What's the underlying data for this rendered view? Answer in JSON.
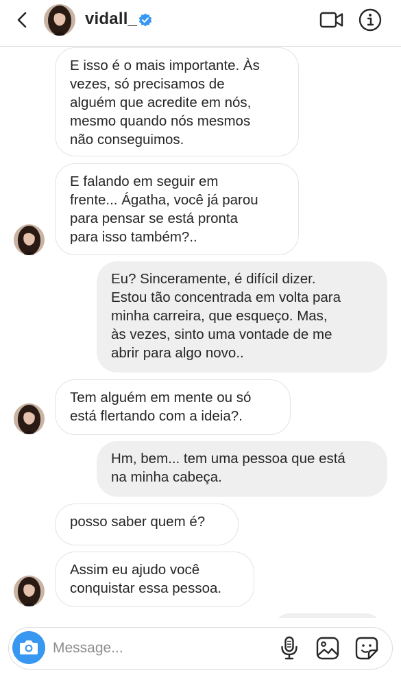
{
  "header": {
    "username": "vidall_",
    "verified": true,
    "icons": {
      "back": "chevron-left-icon",
      "video": "video-camera-icon",
      "info": "info-icon",
      "verified": "verified-badge-icon"
    }
  },
  "messages": [
    {
      "side": "in",
      "show_avatar": false,
      "lines": [
        "E isso é o mais importante. Às",
        "vezes, só precisamos de",
        "alguém que acredite em nós,",
        "mesmo quando nós mesmos",
        "não conseguimos."
      ]
    },
    {
      "side": "in",
      "show_avatar": true,
      "lines": [
        "E falando em seguir em",
        "frente... Ágatha, você já parou",
        "para pensar se está pronta",
        "para isso também?.."
      ]
    },
    {
      "side": "out",
      "show_avatar": false,
      "lines": [
        "Eu? Sinceramente, é difícil dizer.",
        "Estou tão concentrada em volta para",
        "minha carreira, que esqueço. Mas,",
        "às vezes, sinto uma vontade de me",
        "abrir para algo novo.."
      ]
    },
    {
      "side": "in",
      "show_avatar": true,
      "lines": [
        "Tem alguém em mente ou só",
        "está flertando com a ideia?."
      ]
    },
    {
      "side": "out",
      "show_avatar": false,
      "lines": [
        "Hm, bem... tem uma pessoa que está",
        "na minha cabeça."
      ]
    },
    {
      "side": "in",
      "show_avatar": false,
      "lines": [
        "posso saber quem é?"
      ]
    },
    {
      "side": "in",
      "show_avatar": true,
      "lines": [
        "Assim eu ajudo você",
        "conquistar essa pessoa."
      ]
    }
  ],
  "composer": {
    "placeholder": "Message...",
    "value": "",
    "icons": {
      "camera": "camera-icon",
      "mic": "microphone-icon",
      "gallery": "image-icon",
      "sticker": "sticker-icon"
    }
  },
  "colors": {
    "accent": "#3897f0",
    "verified": "#3897f0",
    "outgoing_bubble": "#efefef",
    "incoming_border": "#e3e3e3"
  }
}
